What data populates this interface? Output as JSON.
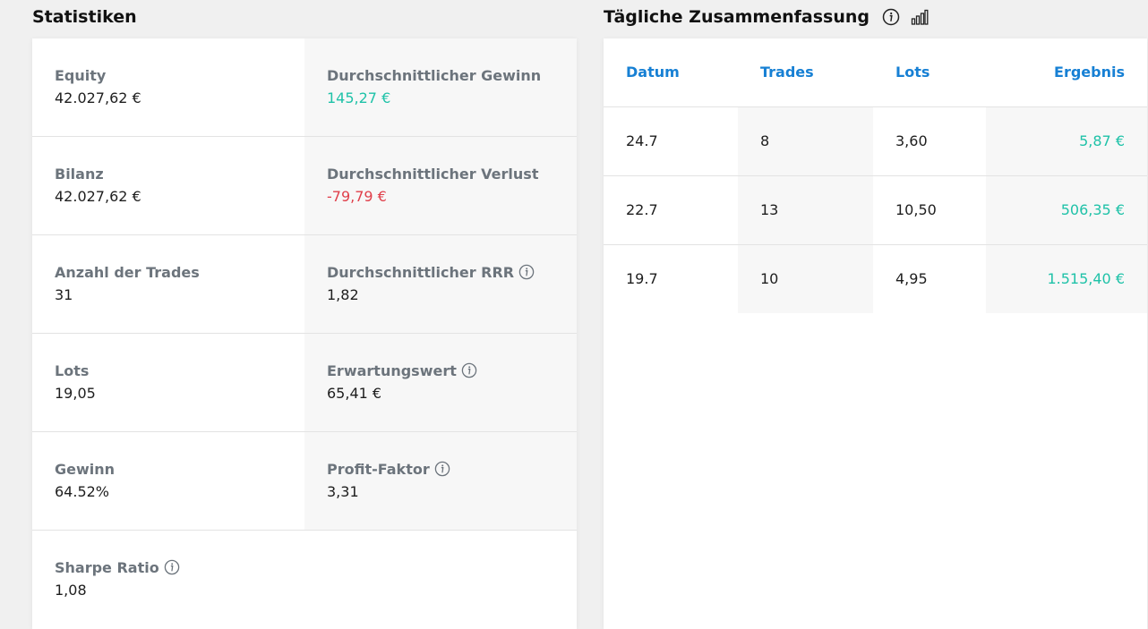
{
  "stats": {
    "title": "Statistiken",
    "rows": [
      {
        "left": {
          "label": "Equity",
          "value": "42.027,62 €"
        },
        "right": {
          "label": "Durchschnittlicher Gewinn",
          "value": "145,27 €"
        }
      },
      {
        "left": {
          "label": "Bilanz",
          "value": "42.027,62 €"
        },
        "right": {
          "label": "Durchschnittlicher Verlust",
          "value": "-79,79 €"
        }
      },
      {
        "left": {
          "label": "Anzahl der Trades",
          "value": "31"
        },
        "right": {
          "label": "Durchschnittlicher RRR",
          "value": "1,82"
        }
      },
      {
        "left": {
          "label": "Lots",
          "value": "19,05"
        },
        "right": {
          "label": "Erwartungswert",
          "value": "65,41 €"
        }
      },
      {
        "left": {
          "label": "Gewinn",
          "value": "64.52%"
        },
        "right": {
          "label": "Profit-Faktor",
          "value": "3,31"
        }
      },
      {
        "left": {
          "label": "Sharpe Ratio",
          "value": "1,08"
        }
      }
    ]
  },
  "daily": {
    "title": "Tägliche Zusammenfassung",
    "columns": [
      "Datum",
      "Trades",
      "Lots",
      "Ergebnis"
    ],
    "rows": [
      {
        "datum": "24.7",
        "trades": "8",
        "lots": "3,60",
        "ergebnis": "5,87 €"
      },
      {
        "datum": "22.7",
        "trades": "13",
        "lots": "10,50",
        "ergebnis": "506,35 €"
      },
      {
        "datum": "19.7",
        "trades": "10",
        "lots": "4,95",
        "ergebnis": "1.515,40 €"
      }
    ]
  },
  "colors": {
    "positive": "#1fc2a8",
    "negative": "#e0404b",
    "header_accent": "#1780d4",
    "label_gray": "#6c747c"
  },
  "icons": {
    "info": "info-circle-icon",
    "chart": "bar-chart-icon"
  }
}
